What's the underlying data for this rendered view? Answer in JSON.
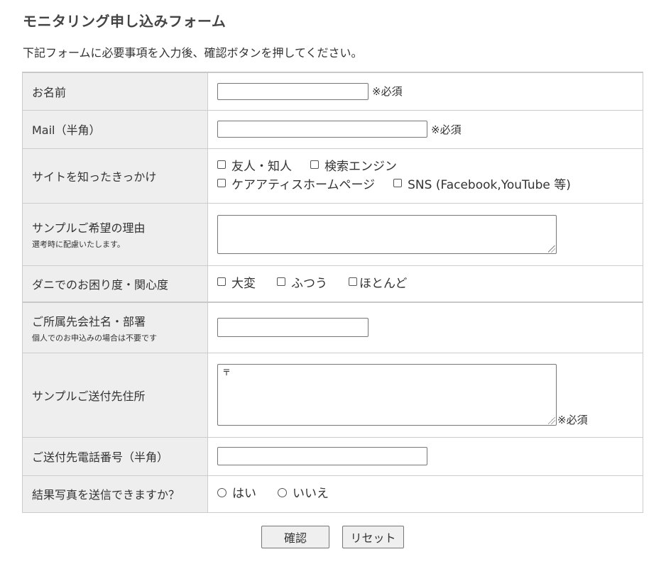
{
  "page": {
    "title": "モニタリング申し込みフォーム",
    "intro": "下記フォームに必要事項を入力後、確認ボタンを押してください。"
  },
  "form": {
    "name": {
      "label": "お名前",
      "value": "",
      "required": "※必須"
    },
    "mail": {
      "label": "Mail（半角）",
      "value": "",
      "required": "※必須"
    },
    "source": {
      "label": "サイトを知ったきっかけ",
      "options": [
        "友人・知人",
        "検索エンジン",
        "ケアアティスホームページ",
        "SNS (Facebook,YouTube 等)"
      ]
    },
    "reason": {
      "label": "サンプルご希望の理由",
      "note": "選考時に配慮いたします。",
      "value": ""
    },
    "concern": {
      "label": "ダニでのお困り度・関心度",
      "options": [
        "大変",
        "ふつう",
        "ほとんど"
      ]
    },
    "company": {
      "label": "ご所属先会社名・部署",
      "note": "個人でのお申込みの場合は不要です",
      "value": ""
    },
    "address": {
      "label": "サンプルご送付先住所",
      "value": "〒",
      "required": "※必須"
    },
    "phone": {
      "label": "ご送付先電話番号（半角）",
      "value": ""
    },
    "photo": {
      "label": "結果写真を送信できますか？",
      "options": [
        "はい",
        "いいえ"
      ]
    }
  },
  "buttons": {
    "confirm": "確認",
    "reset": "リセット"
  }
}
